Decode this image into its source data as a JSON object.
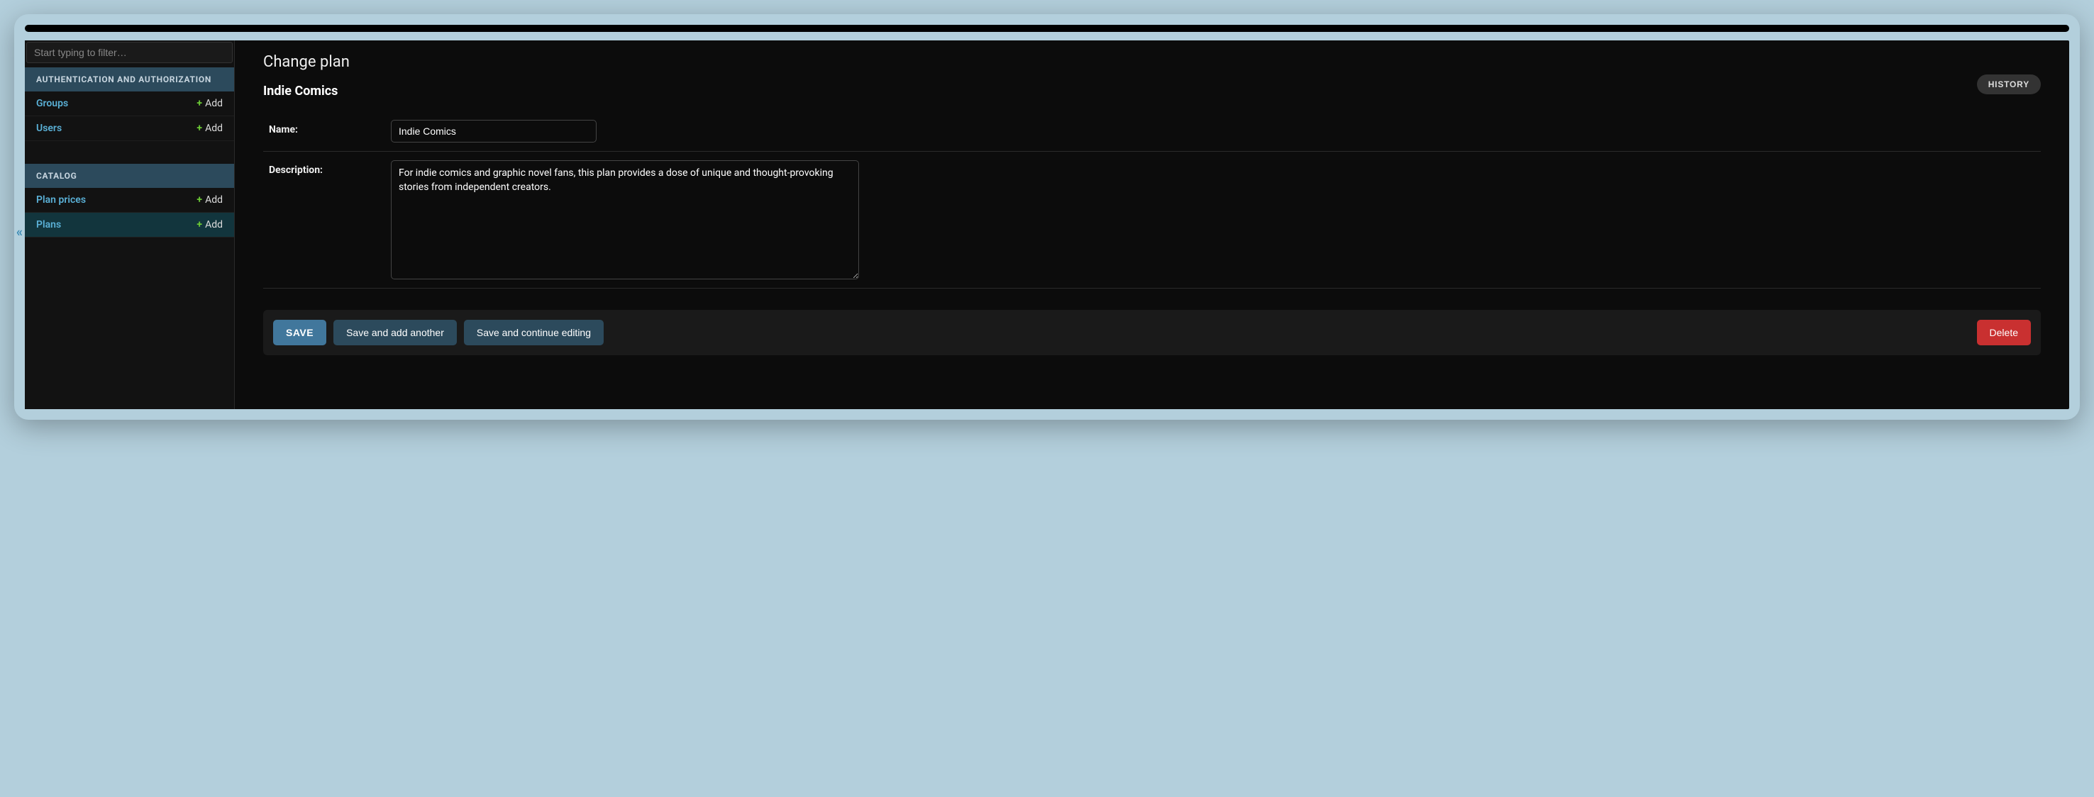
{
  "sidebar": {
    "filter_placeholder": "Start typing to filter…",
    "sections": [
      {
        "title": "AUTHENTICATION AND AUTHORIZATION",
        "items": [
          {
            "label": "Groups",
            "add": "Add",
            "active": false
          },
          {
            "label": "Users",
            "add": "Add",
            "active": false
          }
        ]
      },
      {
        "title": "CATALOG",
        "items": [
          {
            "label": "Plan prices",
            "add": "Add",
            "active": false
          },
          {
            "label": "Plans",
            "add": "Add",
            "active": true
          }
        ]
      }
    ]
  },
  "collapse_glyph": "«",
  "main": {
    "title": "Change plan",
    "history_label": "HISTORY",
    "object_name": "Indie Comics",
    "fields": {
      "name": {
        "label": "Name:",
        "value": "Indie Comics"
      },
      "description": {
        "label": "Description:",
        "value": "For indie comics and graphic novel fans, this plan provides a dose of unique and thought-provoking stories from independent creators."
      }
    },
    "actions": {
      "save": "SAVE",
      "save_add": "Save and add another",
      "save_continue": "Save and continue editing",
      "delete": "Delete"
    }
  }
}
